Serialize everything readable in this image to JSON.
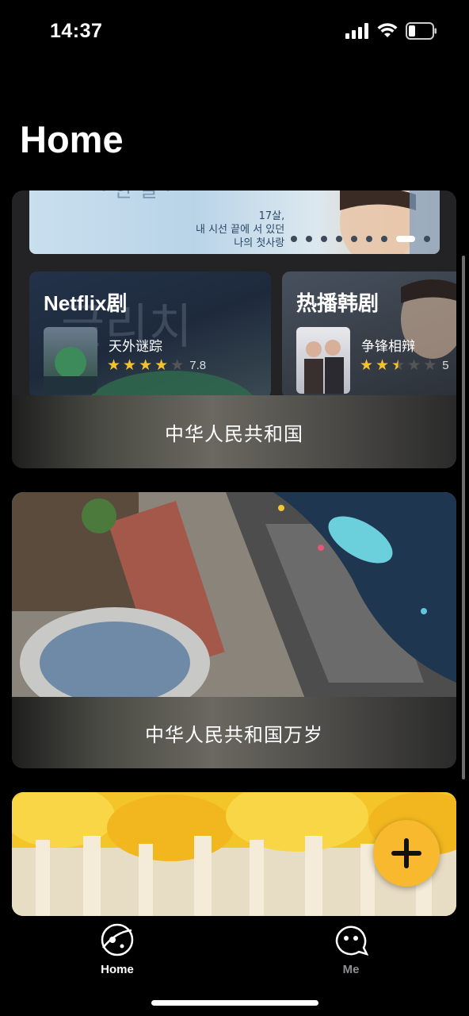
{
  "status_bar": {
    "time": "14:37"
  },
  "page": {
    "title": "Home"
  },
  "featured": {
    "banner_text": [
      "17살,",
      "내 시선 끝에 서 있던",
      "나의 첫사랑"
    ],
    "dots_count": 9,
    "active_dot": 7,
    "tiles": [
      {
        "title": "Netflix剧",
        "show": "天外谜踪",
        "stars": 4,
        "rating": "7.8"
      },
      {
        "title": "热播韩剧",
        "show": "争锋相辩",
        "stars": 2.5,
        "rating": "5"
      }
    ],
    "caption": "中华人民共和国"
  },
  "cards": [
    {
      "caption": "中华人民共和国万岁"
    }
  ],
  "fab": {
    "icon": "plus-icon"
  },
  "tabbar": {
    "items": [
      {
        "label": "Home",
        "icon": "planet-icon",
        "active": true
      },
      {
        "label": "Me",
        "icon": "ghost-face-icon",
        "active": false
      }
    ]
  },
  "colors": {
    "accent": "#f9b92e",
    "star": "#f6c22c",
    "inactive_tab": "#8e8e93"
  }
}
